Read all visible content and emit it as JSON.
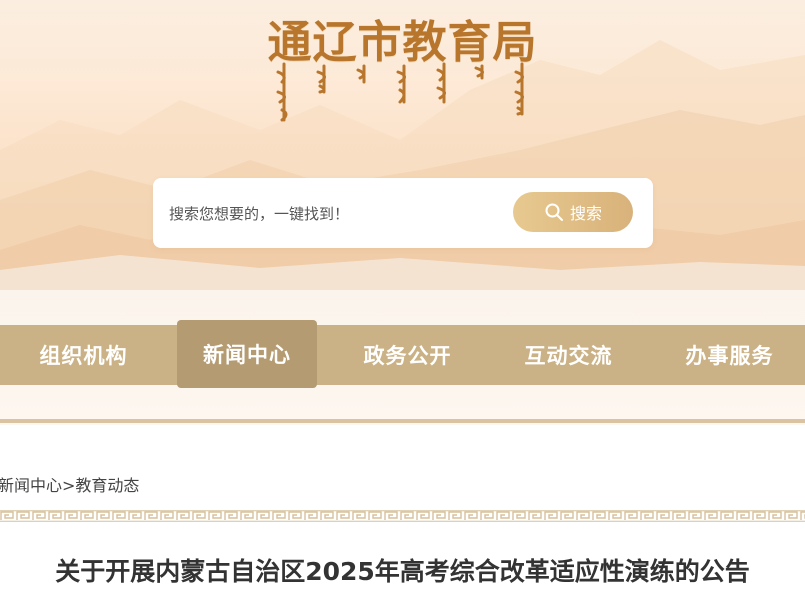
{
  "header": {
    "site_title": "通辽市教育局"
  },
  "search": {
    "placeholder": "搜索您想要的，一键找到！",
    "button_label": "搜索"
  },
  "nav": {
    "items": [
      {
        "label": "组织机构"
      },
      {
        "label": "新闻中心"
      },
      {
        "label": "政务公开"
      },
      {
        "label": "互动交流"
      },
      {
        "label": "办事服务"
      }
    ],
    "active_index": 1
  },
  "breadcrumb": {
    "section": "新闻中心",
    "separator": ">",
    "current": "教育动态"
  },
  "article": {
    "title": "关于开展内蒙古自治区2025年高考综合改革适应性演练的公告"
  },
  "colors": {
    "title_gold": "#b8752c",
    "nav_bg": "#cbb286",
    "nav_active": "#b49b72",
    "search_button": "#d8b27a"
  }
}
